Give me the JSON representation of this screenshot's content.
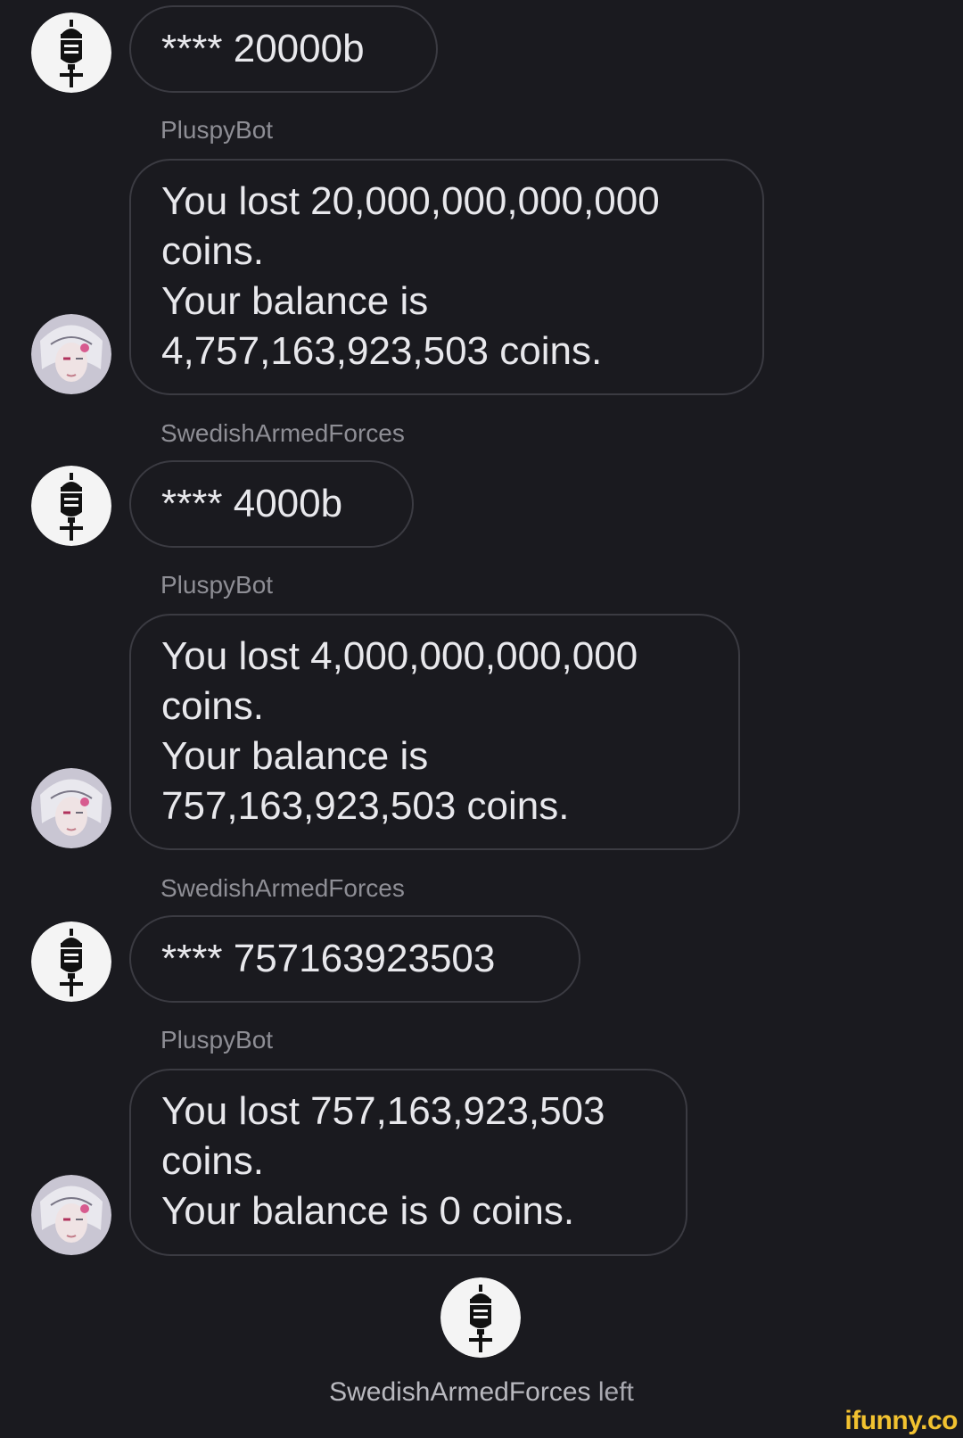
{
  "messages": [
    {
      "sender": "",
      "lines": [
        "**** 20000b"
      ]
    },
    {
      "sender": "PluspyBot",
      "lines": [
        "You lost 20,000,000,000,000",
        "coins.",
        "Your balance is",
        "4,757,163,923,503 coins."
      ]
    },
    {
      "sender": "SwedishArmedForces",
      "lines": [
        "**** 4000b"
      ]
    },
    {
      "sender": "PluspyBot",
      "lines": [
        "You lost 4,000,000,000,000",
        "coins.",
        "Your balance is",
        "757,163,923,503 coins."
      ]
    },
    {
      "sender": "SwedishArmedForces",
      "lines": [
        "**** 757163923503"
      ]
    },
    {
      "sender": "PluspyBot",
      "lines": [
        "You lost 757,163,923,503",
        "coins.",
        "Your balance is 0 coins."
      ]
    }
  ],
  "system": {
    "user": "SwedishArmedForces",
    "action": "left"
  },
  "watermark": "ifunny.co",
  "colors": {
    "background": "#1a1a1f",
    "bubble_border": "#3b3b42",
    "sender": "#8e8e95",
    "watermark": "#f2c230"
  },
  "icons": {
    "army_avatar": "swedish-armed-forces-emblem",
    "bot_avatar": "anime-character-portrait"
  }
}
